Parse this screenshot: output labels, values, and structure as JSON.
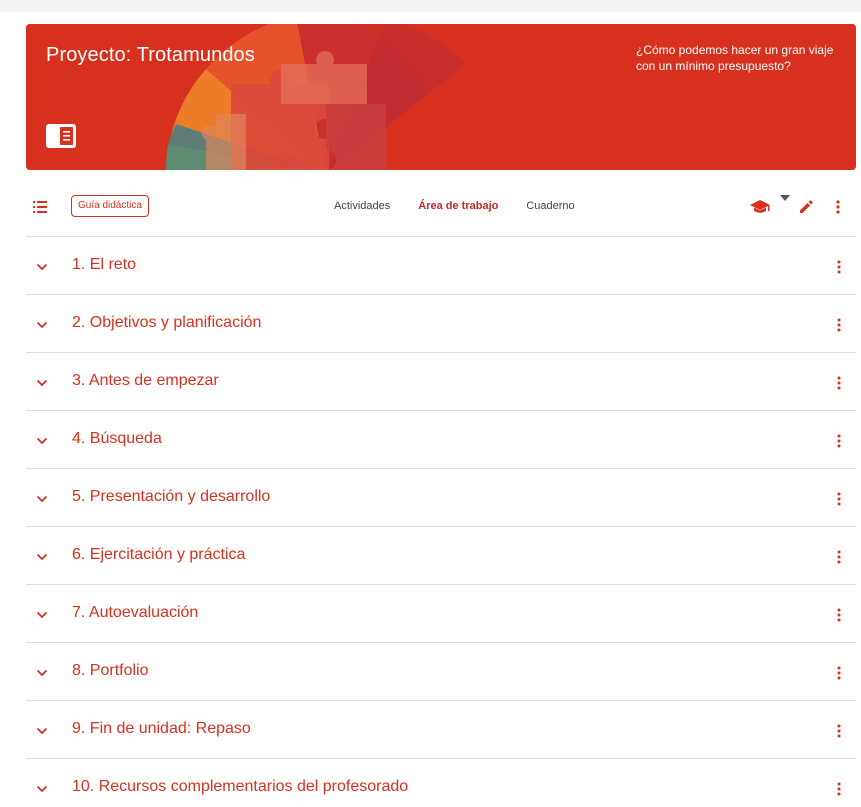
{
  "banner": {
    "title": "Proyecto: Trotamundos",
    "question": "¿Cómo podemos hacer un gran viaje con un mínimo presupuesto?",
    "icon": "book-icon"
  },
  "toolbar": {
    "guia_label": "Guía didáctica",
    "tabs": [
      {
        "label": "Actividades",
        "active": false
      },
      {
        "label": "Área de trabajo",
        "active": true
      },
      {
        "label": "Cuaderno",
        "active": false
      }
    ],
    "icons": [
      "list-icon",
      "mortarboard-icon",
      "caret-down-icon",
      "pencil-icon",
      "more-vert-icon"
    ]
  },
  "sections": [
    {
      "label": "1. El reto"
    },
    {
      "label": "2. Objetivos y planificación"
    },
    {
      "label": "3. Antes de empezar"
    },
    {
      "label": "4. Búsqueda"
    },
    {
      "label": "5. Presentación y desarrollo"
    },
    {
      "label": "6. Ejercitación y práctica"
    },
    {
      "label": "7. Autoevaluación"
    },
    {
      "label": "8. Portfolio"
    },
    {
      "label": "9. Fin de unidad: Repaso"
    },
    {
      "label": "10. Recursos complementarios del profesorado"
    }
  ],
  "colors": {
    "accent": "#d7301f",
    "tab_active": "#c62828",
    "text_muted": "#444444",
    "divider": "#dedede"
  }
}
